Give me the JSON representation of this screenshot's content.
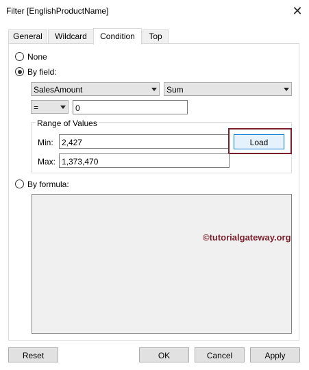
{
  "window": {
    "title": "Filter [EnglishProductName]"
  },
  "tabs": [
    {
      "label": "General"
    },
    {
      "label": "Wildcard"
    },
    {
      "label": "Condition"
    },
    {
      "label": "Top"
    }
  ],
  "condition": {
    "none_label": "None",
    "by_field_label": "By field:",
    "field_select": "SalesAmount",
    "aggregation_select": "Sum",
    "operator_select": "=",
    "value_input": "0",
    "range": {
      "legend": "Range of Values",
      "min_label": "Min:",
      "min_value": "2,427",
      "max_label": "Max:",
      "max_value": "1,373,470",
      "load_label": "Load"
    },
    "by_formula_label": "By formula:"
  },
  "watermark": "©tutorialgateway.org",
  "footer": {
    "reset_label": "Reset",
    "ok_label": "OK",
    "cancel_label": "Cancel",
    "apply_label": "Apply"
  },
  "icons": {
    "close": "close-icon"
  }
}
